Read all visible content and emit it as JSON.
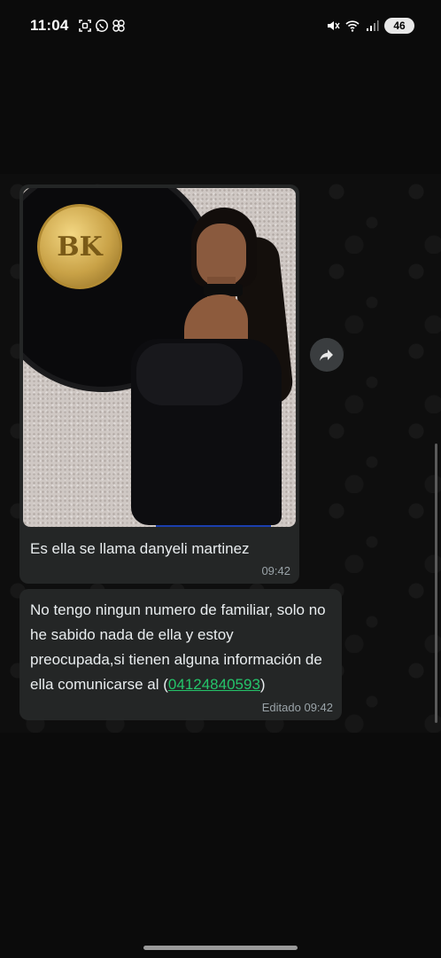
{
  "status_bar": {
    "time": "11:04",
    "battery": "46",
    "left_icons": [
      "screenshot-icon",
      "whatsapp-icon",
      "pinwheel-icon"
    ],
    "right_icons": [
      "mute-icon",
      "wifi-icon",
      "signal-icon",
      "battery-icon"
    ]
  },
  "chat": {
    "messages": [
      {
        "type": "image",
        "caption": "Es ella se llama danyeli martinez",
        "time": "09:42",
        "image_text": "BK"
      },
      {
        "type": "text",
        "text_before_link": "No tengo ningun numero de familiar, solo no he sabido nada de ella y estoy preocupada,si tienen alguna información de ella comunicarse al (",
        "link": "04124840593",
        "text_after_link": ")",
        "time": "Editado 09:42"
      }
    ],
    "forward_icon": "forward-icon"
  },
  "colors": {
    "background": "#0b0b0b",
    "bubble": "#242626",
    "link": "#25c46a",
    "timestamp": "#9aa3a8"
  }
}
